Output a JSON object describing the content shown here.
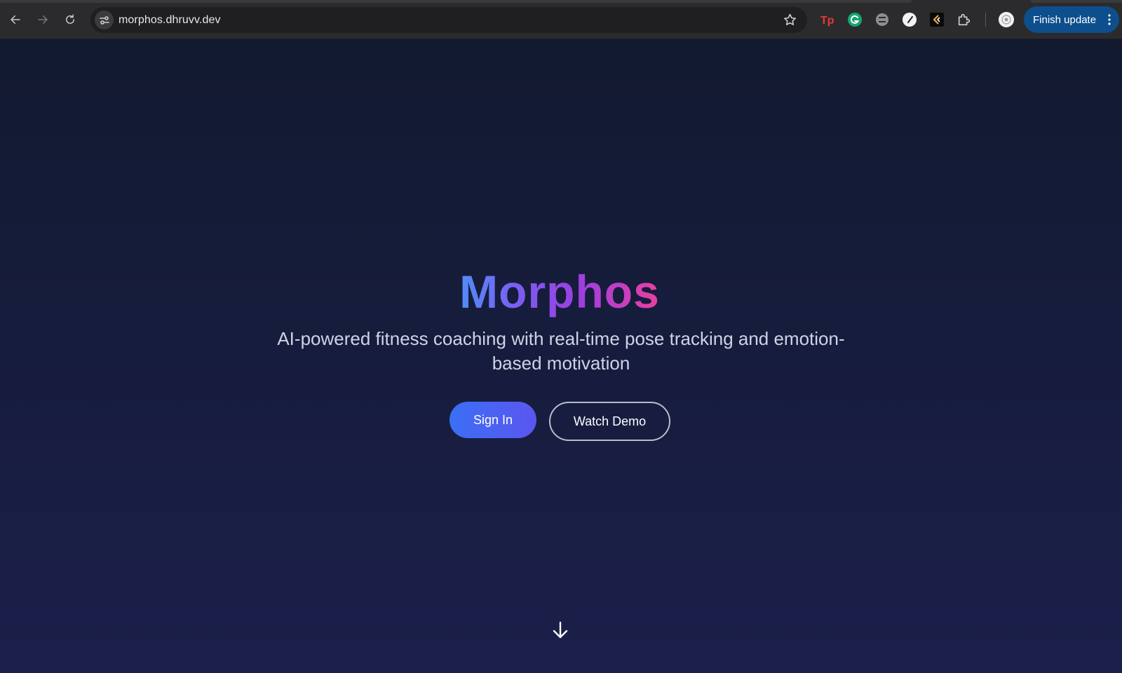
{
  "browser": {
    "url": "morphos.dhruvv.dev",
    "finish_update_label": "Finish update",
    "icons": {
      "back": "back-arrow-icon",
      "forward": "forward-arrow-icon",
      "reload": "reload-icon",
      "site_settings": "tune-icon",
      "bookmark": "star-icon",
      "extensions": [
        "typingpro-extension-icon",
        "grammarly-extension-icon",
        "blocker-extension-icon",
        "compass-extension-icon",
        "dark-extension-icon",
        "puzzle-extensions-icon"
      ],
      "profile": "avatar-icon",
      "menu": "more-vert-icon"
    },
    "colors": {
      "finish_update_bg": "#0d4f8c",
      "toolbar_bg": "#2b2b2e"
    }
  },
  "hero": {
    "title": "Morphos",
    "subtitle": "AI-powered fitness coaching with real-time pose tracking and emotion-based motivation",
    "sign_in_label": "Sign In",
    "watch_demo_label": "Watch Demo",
    "scroll_icon": "arrow-down-icon"
  },
  "colors": {
    "title_gradient": [
      "#4f8ef7",
      "#9b3fe0",
      "#ec3fa1"
    ],
    "primary_button": "#3b6ff5",
    "page_bg": "#161c3c"
  }
}
